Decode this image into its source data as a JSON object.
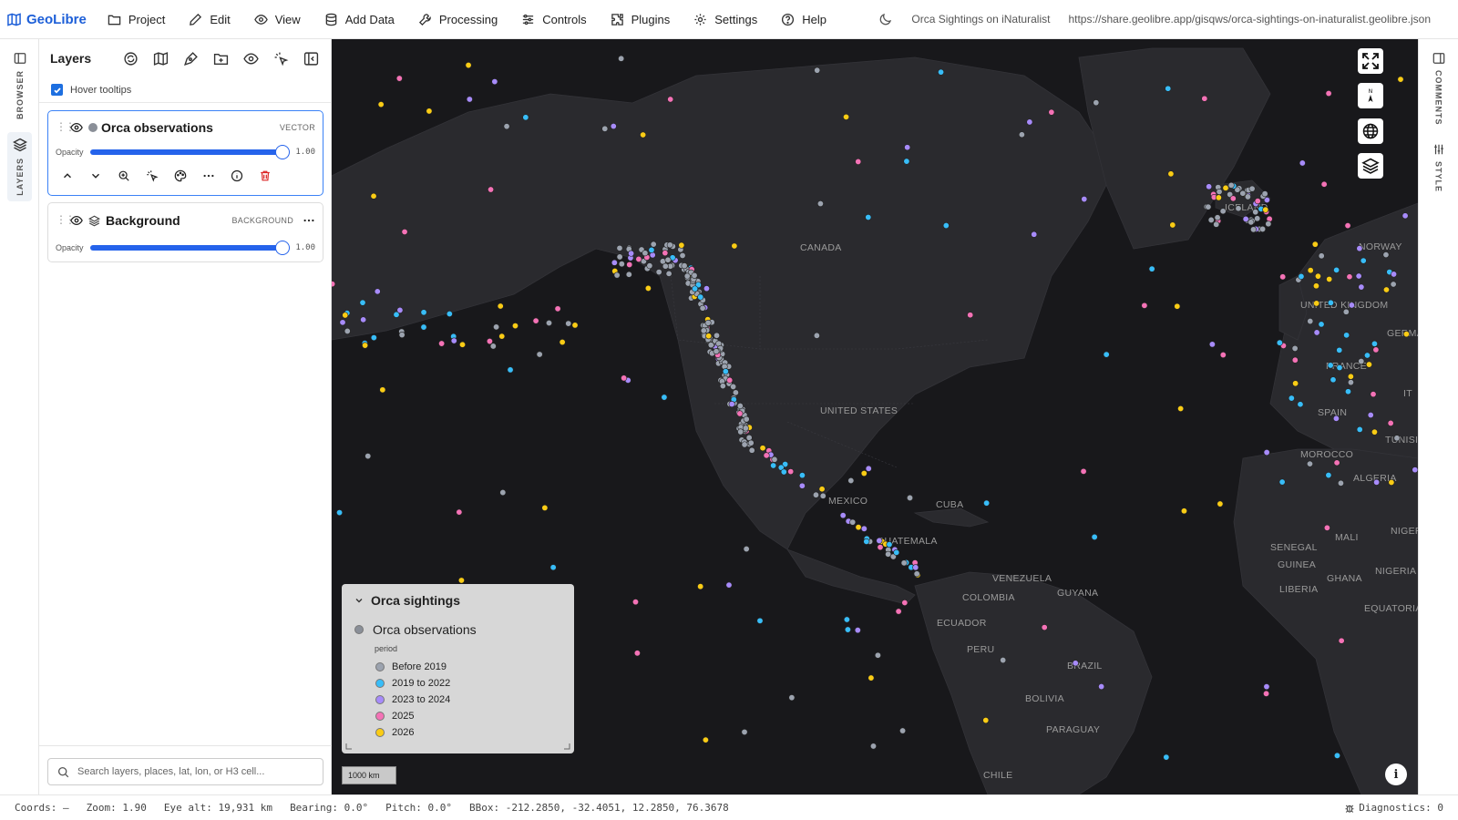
{
  "app": {
    "name": "GeoLibre",
    "brand_color": "#1d5fd8"
  },
  "menu": [
    {
      "label": "Project",
      "icon": "folder-icon"
    },
    {
      "label": "Edit",
      "icon": "pencil-icon"
    },
    {
      "label": "View",
      "icon": "eye-icon"
    },
    {
      "label": "Add Data",
      "icon": "database-icon"
    },
    {
      "label": "Processing",
      "icon": "wrench-icon"
    },
    {
      "label": "Controls",
      "icon": "sliders-icon"
    },
    {
      "label": "Plugins",
      "icon": "puzzle-icon"
    },
    {
      "label": "Settings",
      "icon": "gear-icon"
    },
    {
      "label": "Help",
      "icon": "help-circle-icon"
    }
  ],
  "header": {
    "project_title": "Orca Sightings on iNaturalist",
    "share_url": "https://share.geolibre.app/gisqws/orca-sightings-on-inaturalist.geolibre.json"
  },
  "left_rail": {
    "browser_label": "BROWSER",
    "layers_label": "LAYERS"
  },
  "right_rail": {
    "comments_label": "COMMENTS",
    "style_label": "STYLE"
  },
  "panel": {
    "title": "Layers",
    "hover_tooltips_label": "Hover tooltips",
    "hover_tooltips_checked": true,
    "layers": [
      {
        "name": "Orca observations",
        "type": "VECTOR",
        "opacity_label": "Opacity",
        "opacity": "1.00"
      },
      {
        "name": "Background",
        "type": "BACKGROUND",
        "opacity_label": "Opacity",
        "opacity": "1.00"
      }
    ],
    "search_placeholder": "Search layers, places, lat, lon, or H3 cell..."
  },
  "map": {
    "labels": [
      "CANADA",
      "UNITED STATES",
      "MEXICO",
      "CUBA",
      "GUATEMALA",
      "VENEZUELA",
      "COLOMBIA",
      "GUYANA",
      "ECUADOR",
      "PERU",
      "BRAZIL",
      "BOLIVIA",
      "PARAGUAY",
      "CHILE",
      "ICELAND",
      "NORWAY",
      "UNITED KINGDOM",
      "GERMA",
      "FRANCE",
      "SPAIN",
      "MOROCCO",
      "TUNISI",
      "ALGERIA",
      "MALI",
      "NIGER",
      "SENEGAL",
      "GUINEA",
      "GHANA",
      "NIGERIA",
      "LIBERIA",
      "EQUATORIAL",
      "IT"
    ],
    "scale_label": "1000 km"
  },
  "legend": {
    "title": "Orca sightings",
    "layer_name": "Orca observations",
    "field": "period",
    "items": [
      {
        "label": "Before 2019",
        "color": "#9ca3af"
      },
      {
        "label": "2019 to 2022",
        "color": "#38bdf8"
      },
      {
        "label": "2023 to 2024",
        "color": "#a78bfa"
      },
      {
        "label": "2025",
        "color": "#f472b6"
      },
      {
        "label": "2026",
        "color": "#facc15"
      }
    ]
  },
  "status": {
    "coords": "Coords: —",
    "zoom": "Zoom: 1.90",
    "eye_alt": "Eye alt: 19,931 km",
    "bearing": "Bearing: 0.0°",
    "pitch": "Pitch: 0.0°",
    "bbox": "BBox: -212.2850, -32.4051, 12.2850, 76.3678",
    "diagnostics": "Diagnostics: 0"
  }
}
